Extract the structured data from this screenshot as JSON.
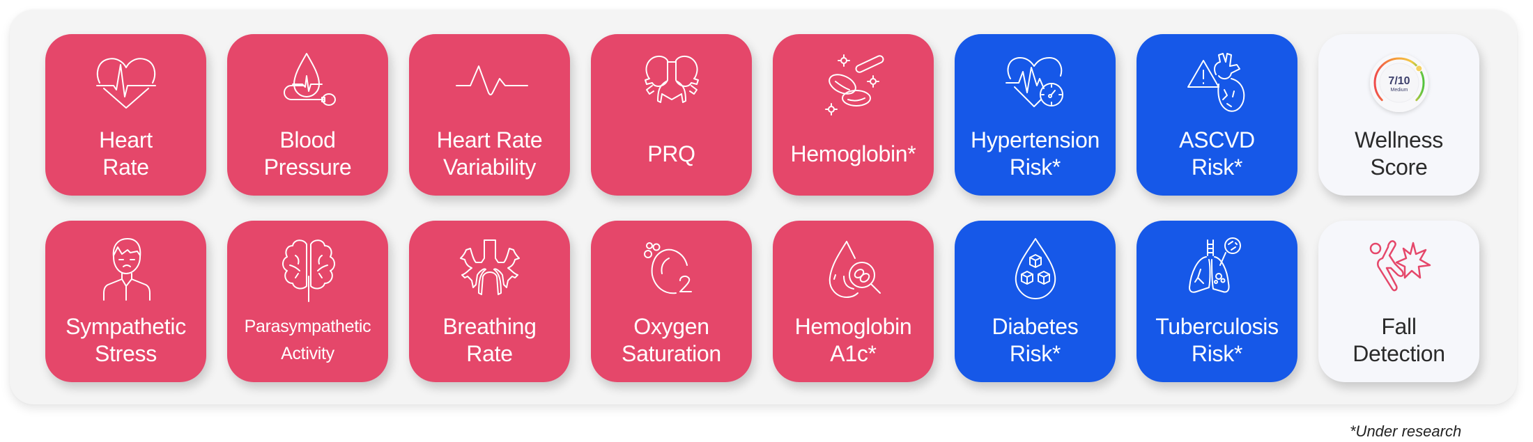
{
  "colors": {
    "pink": "#e5476a",
    "blue": "#1658e8",
    "light": "#f6f7fb",
    "panel": "#f4f4f4"
  },
  "cards": [
    {
      "id": "heart-rate",
      "lines": [
        "Heart",
        "Rate"
      ],
      "theme": "pink",
      "icon": "heart-pulse-icon"
    },
    {
      "id": "blood-pressure",
      "lines": [
        "Blood",
        "Pressure"
      ],
      "theme": "pink",
      "icon": "blood-pressure-drop-icon"
    },
    {
      "id": "heart-rate-variability",
      "lines": [
        "Heart Rate",
        "Variability"
      ],
      "theme": "pink",
      "icon": "waveform-icon"
    },
    {
      "id": "prq",
      "lines": [
        "PRQ"
      ],
      "theme": "pink",
      "icon": "lungs-icon"
    },
    {
      "id": "hemoglobin",
      "lines": [
        "Hemoglobin*"
      ],
      "theme": "pink",
      "icon": "blood-cells-icon"
    },
    {
      "id": "hypertension-risk",
      "lines": [
        "Hypertension",
        "Risk*"
      ],
      "theme": "blue",
      "icon": "heart-gauge-icon"
    },
    {
      "id": "ascvd-risk",
      "lines": [
        "ASCVD",
        "Risk*"
      ],
      "theme": "blue",
      "icon": "heart-warning-icon"
    },
    {
      "id": "wellness-score",
      "lines": [
        "Wellness",
        "Score"
      ],
      "theme": "light",
      "icon": "score-gauge-icon"
    },
    {
      "id": "sympathetic-stress",
      "lines": [
        "Sympathetic",
        "Stress"
      ],
      "theme": "pink",
      "icon": "stressed-person-icon"
    },
    {
      "id": "parasympathetic-activity",
      "lines": [
        "Parasympathetic",
        "Activity"
      ],
      "theme": "pink",
      "icon": "brain-icon",
      "small": true
    },
    {
      "id": "breathing-rate",
      "lines": [
        "Breathing",
        "Rate"
      ],
      "theme": "pink",
      "icon": "bronchi-icon"
    },
    {
      "id": "oxygen-saturation",
      "lines": [
        "Oxygen",
        "Saturation"
      ],
      "theme": "pink",
      "icon": "oxygen-o2-icon"
    },
    {
      "id": "hemoglobin-a1c",
      "lines": [
        "Hemoglobin",
        "A1c*"
      ],
      "theme": "pink",
      "icon": "blood-drop-magnifier-icon"
    },
    {
      "id": "diabetes-risk",
      "lines": [
        "Diabetes",
        "Risk*"
      ],
      "theme": "blue",
      "icon": "sugar-cubes-drop-icon"
    },
    {
      "id": "tuberculosis-risk",
      "lines": [
        "Tuberculosis",
        "Risk*"
      ],
      "theme": "blue",
      "icon": "lungs-bacteria-icon"
    },
    {
      "id": "fall-detection",
      "lines": [
        "Fall",
        "Detection"
      ],
      "theme": "light",
      "icon": "falling-person-icon"
    }
  ],
  "wellness_gauge": {
    "value_text": "7/10",
    "level_text": "Medium",
    "value": 7,
    "max": 10
  },
  "footnote": "*Under research"
}
